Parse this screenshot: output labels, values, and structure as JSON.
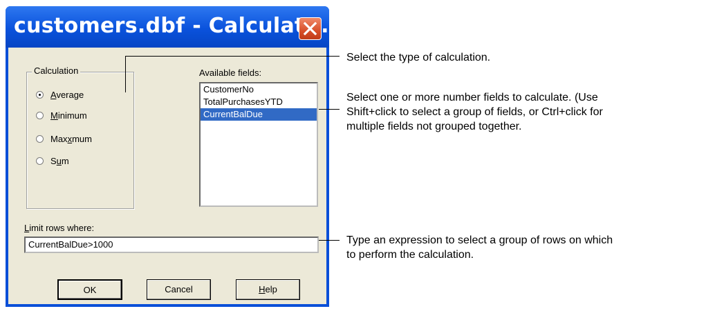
{
  "dialog": {
    "title": "customers.dbf - Calculat...",
    "close_icon": "close-icon",
    "calculation": {
      "label": "Calculation",
      "options": [
        {
          "label": "Average",
          "selected": true
        },
        {
          "label": "Minimum",
          "selected": false
        },
        {
          "label": "Maximum",
          "selected": false
        },
        {
          "label": "Sum",
          "selected": false
        }
      ]
    },
    "available_fields": {
      "label": "Available fields:",
      "items": [
        {
          "label": "CustomerNo",
          "selected": false
        },
        {
          "label": "TotalPurchasesYTD",
          "selected": false
        },
        {
          "label": "CurrentBalDue",
          "selected": true
        }
      ]
    },
    "limit": {
      "label": "Limit rows where:",
      "value": "CurrentBalDue>1000"
    },
    "buttons": {
      "ok": "OK",
      "cancel": "Cancel",
      "help": "Help"
    }
  },
  "annotations": {
    "calc": "Select the type of calculation.",
    "fields_1": "Select one or more number fields to calculate. (Use",
    "fields_2": "Shift+click to select a group of fields, or Ctrl+click for",
    "fields_3": "multiple fields not grouped together.",
    "expr_1": "Type an expression to select a group of rows on which",
    "expr_2": "to perform the calculation."
  },
  "colors": {
    "titlebar": "#0a52dc",
    "selection": "#316ac5",
    "dialog_face": "#ece9d8",
    "close_button": "#d8502a"
  }
}
